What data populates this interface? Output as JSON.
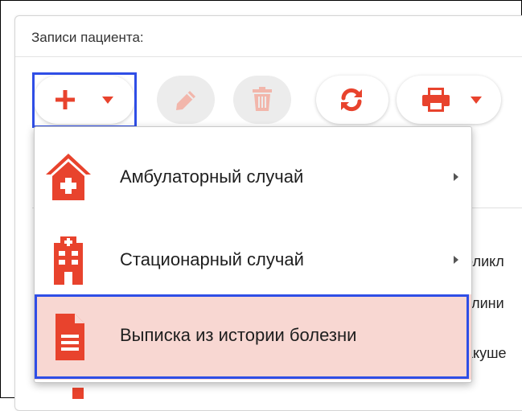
{
  "panel": {
    "title": "Записи пациента:"
  },
  "toolbar": {
    "add": {
      "icon": "plus-icon",
      "dropdown_icon": "caret-down-icon"
    },
    "edit": {
      "icon": "pencil-icon",
      "disabled": true
    },
    "delete": {
      "icon": "trash-icon",
      "disabled": true
    },
    "refresh": {
      "icon": "refresh-icon"
    },
    "print": {
      "icon": "printer-icon",
      "dropdown_icon": "caret-down-icon"
    }
  },
  "add_menu": {
    "items": [
      {
        "label": "Амбулаторный случай",
        "icon": "house-medical-icon",
        "has_submenu": true
      },
      {
        "label": "Стационарный случай",
        "icon": "hospital-icon",
        "has_submenu": true
      },
      {
        "label": "Выписка из истории болезни",
        "icon": "document-icon",
        "has_submenu": false,
        "highlighted": true
      }
    ]
  },
  "background_list": {
    "fragments": [
      "оликл",
      "клини",
      "акуше"
    ]
  },
  "colors": {
    "accent": "#e8432d",
    "highlight_bg": "#f8d7d2",
    "selection_outline": "#2f4ee6"
  }
}
